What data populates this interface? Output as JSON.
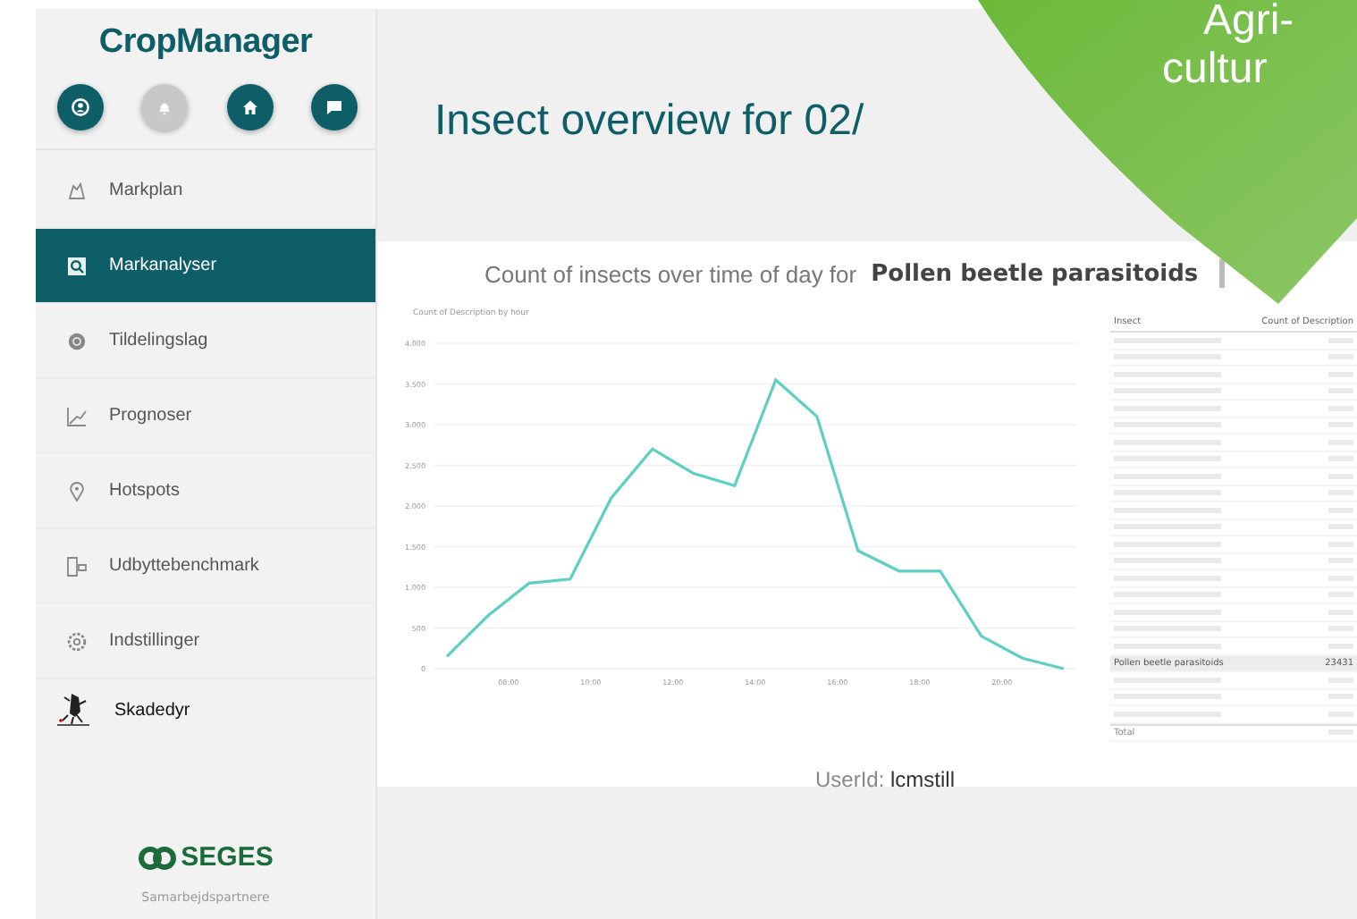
{
  "sidebar": {
    "logo": "CropManager",
    "quick_buttons": [
      {
        "kind": "user",
        "disabled": false
      },
      {
        "kind": "bell",
        "disabled": true
      },
      {
        "kind": "home",
        "disabled": false
      },
      {
        "kind": "chat",
        "disabled": false
      }
    ],
    "items": [
      {
        "kind": "map",
        "label": "Markplan",
        "selected": false
      },
      {
        "kind": "analysis",
        "label": "Markanalyser",
        "selected": true
      },
      {
        "kind": "layers",
        "label": "Tildelingslag",
        "selected": false
      },
      {
        "kind": "graph",
        "label": "Prognoser",
        "selected": false
      },
      {
        "kind": "pin",
        "label": "Hotspots",
        "selected": false
      },
      {
        "kind": "bench",
        "label": "Udbyttebenchmark",
        "selected": false
      },
      {
        "kind": "gear",
        "label": "Indstillinger",
        "selected": false
      },
      {
        "kind": "insect",
        "label": "Skadedyr",
        "selected": false
      }
    ],
    "partner_logo": "SEGES",
    "partner_caption": "Samarbejdspartnere"
  },
  "page_title": "Insect overview for 02/",
  "badge": {
    "lines": [
      "Agri-",
      "cultur"
    ]
  },
  "report": {
    "heading": "Count of insects over time of day for",
    "heading_value": "Pollen beetle parasitoids",
    "chart_data": {
      "type": "line",
      "title": "Count of Description by hour",
      "x": [
        6.5,
        7.5,
        8.5,
        9.5,
        10.5,
        11.5,
        12.5,
        13.5,
        14.5,
        15.5,
        16.5,
        17.5,
        18.5,
        19.5,
        20.5,
        21.5
      ],
      "series": [
        {
          "color": "#5ecfc1",
          "values": [
            150,
            650,
            1050,
            1100,
            2100,
            2700,
            2400,
            2250,
            3550,
            3100,
            1450,
            1200,
            1200,
            400,
            130,
            0
          ]
        }
      ],
      "xlim": [
        6.2,
        21.8
      ],
      "ylim": [
        0,
        4000
      ],
      "grid": true,
      "xticks": [
        {
          "value": 8,
          "label": "08:00"
        },
        {
          "value": 10,
          "label": "10:00"
        },
        {
          "value": 12,
          "label": "12:00"
        },
        {
          "value": 14,
          "label": "14:00"
        },
        {
          "value": 16,
          "label": "16:00"
        },
        {
          "value": 18,
          "label": "18:00"
        },
        {
          "value": 20,
          "label": "20:00"
        }
      ],
      "yticks": [
        {
          "value": 0,
          "label": "0"
        },
        {
          "value": 500,
          "label": "500"
        },
        {
          "value": 1000,
          "label": "1.000"
        },
        {
          "value": 1500,
          "label": "1.500"
        },
        {
          "value": 2000,
          "label": "2.000"
        },
        {
          "value": 2500,
          "label": "2.500"
        },
        {
          "value": 3000,
          "label": "3.000"
        },
        {
          "value": 3500,
          "label": "3.500"
        },
        {
          "value": 4000,
          "label": "4.000"
        }
      ]
    },
    "table": {
      "columns": [
        "Insect",
        "Count of Description"
      ],
      "rows": [
        {
          "kind": "blurred",
          "selected": false
        },
        {
          "kind": "blurred",
          "selected": false
        },
        {
          "kind": "blurred",
          "selected": false
        },
        {
          "kind": "blurred",
          "selected": false
        },
        {
          "kind": "blurred",
          "selected": false
        },
        {
          "kind": "blurred",
          "selected": false
        },
        {
          "kind": "blurred",
          "selected": false
        },
        {
          "kind": "blurred",
          "selected": false
        },
        {
          "kind": "blurred",
          "selected": false
        },
        {
          "kind": "blurred",
          "selected": false
        },
        {
          "kind": "blurred",
          "selected": false
        },
        {
          "kind": "blurred",
          "selected": false
        },
        {
          "kind": "blurred",
          "selected": false
        },
        {
          "kind": "blurred",
          "selected": false
        },
        {
          "kind": "blurred",
          "selected": false
        },
        {
          "kind": "blurred",
          "selected": false
        },
        {
          "kind": "blurred",
          "selected": false
        },
        {
          "kind": "blurred",
          "selected": false
        },
        {
          "kind": "blurred",
          "selected": false
        },
        {
          "kind": "text",
          "insect": "Pollen beetle parasitoids",
          "count": "23431",
          "selected": true
        },
        {
          "kind": "blurred",
          "selected": false
        },
        {
          "kind": "blurred",
          "selected": false
        },
        {
          "kind": "blurred",
          "selected": false
        },
        {
          "kind": "total",
          "insect": "Total",
          "selected": false
        }
      ]
    },
    "user_label": "UserId:",
    "user_value": "lcmstill"
  }
}
